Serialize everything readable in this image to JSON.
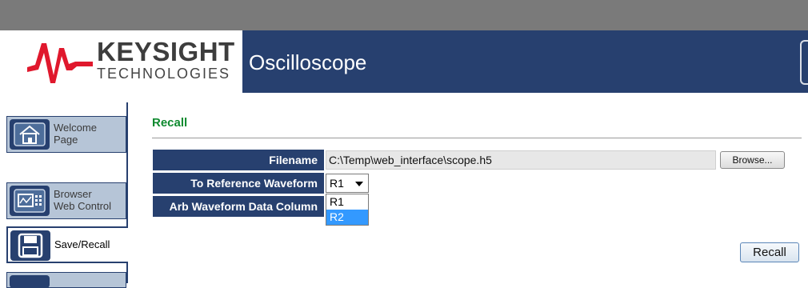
{
  "header": {
    "logo_name": "KEYSIGHT",
    "logo_sub": "TECHNOLOGIES",
    "app_title": "Oscilloscope"
  },
  "sidebar": {
    "items": [
      {
        "label_line1": "Welcome",
        "label_line2": "Page",
        "icon": "home-icon",
        "active": false
      },
      {
        "label_line1": "Browser",
        "label_line2": "Web Control",
        "icon": "browser-control-icon",
        "active": false
      },
      {
        "label_line1": "Save/Recall",
        "label_line2": "",
        "icon": "floppy-disk-icon",
        "active": true
      },
      {
        "label_line1": "",
        "label_line2": "",
        "icon": "generic-page-icon",
        "active": false
      }
    ]
  },
  "main": {
    "title": "Recall",
    "filename_label": "Filename",
    "filename_value": "C:\\Temp\\web_interface\\scope.h5",
    "browse_label": "Browse...",
    "ref_label": "To Reference Waveform",
    "ref_selected": "R1",
    "ref_options": [
      "R1",
      "R2"
    ],
    "ref_highlighted": "R2",
    "arb_label": "Arb Waveform Data Column",
    "recall_label": "Recall"
  },
  "colors": {
    "header_bg": "#27406f",
    "title_green": "#0e8a2f",
    "logo_red": "#e0182d",
    "highlight": "#3399ff"
  }
}
